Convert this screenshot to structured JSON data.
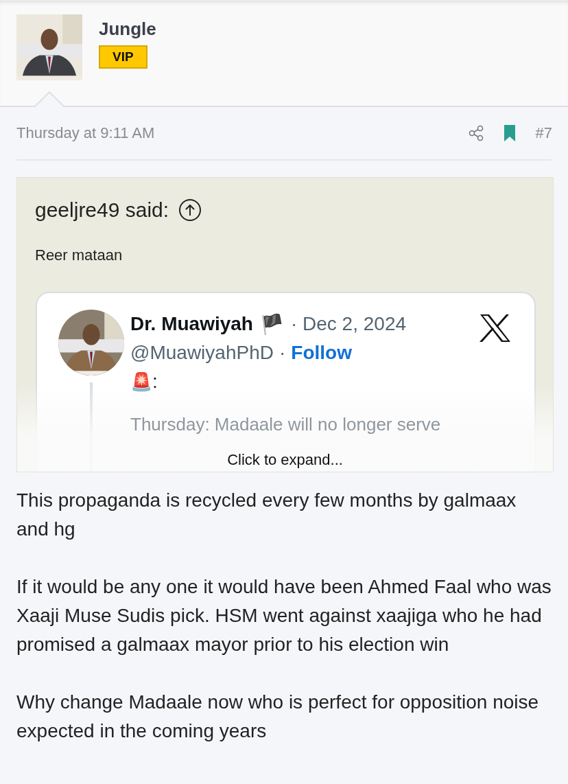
{
  "author": {
    "name": "Jungle",
    "badge": "VIP"
  },
  "post": {
    "time": "Thursday at 9:11 AM",
    "bookmarked": true,
    "number": "#7"
  },
  "quote": {
    "attribution": "geeljre49 said:",
    "text": "Reer mataan",
    "tweet": {
      "name": "Dr. Muawiyah",
      "flag": "🏴",
      "date": "· Dec 2, 2024",
      "handle": "@MuawiyahPhD",
      "separator": "·",
      "follow": "Follow",
      "emoji": "🚨",
      "colon": ":",
      "body": "Thursday: Madaale will no longer serve"
    },
    "expand": "Click to expand..."
  },
  "paragraphs": [
    "This propaganda is recycled every few months by galmaax and hg",
    "If it would be any one it would have been Ahmed Faal who was Xaaji Muse Sudis pick. HSM went against xaajiga who he had promised a galmaax mayor prior to his election win",
    "Why change Madaale now who is perfect for opposition noise expected in the coming years"
  ]
}
